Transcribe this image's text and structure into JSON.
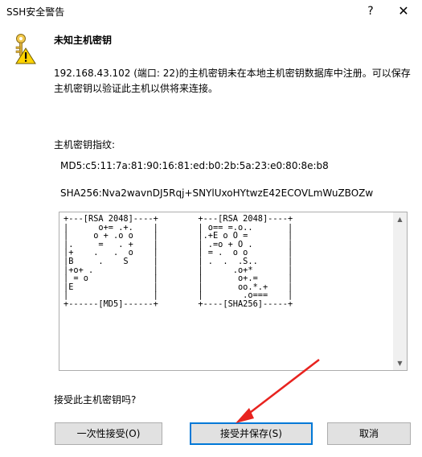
{
  "window": {
    "title": "SSH安全警告",
    "help_label": "?",
    "close_label": "✕"
  },
  "dialog": {
    "icon": "warning-key-icon",
    "heading": "未知主机密钥",
    "message": "192.168.43.102 (端口: 22)的主机密钥未在本地主机密钥数据库中注册。可以保存主机密钥以验证此主机以供将来连接。",
    "fingerprint_label": "主机密钥指纹:",
    "md5": "MD5:c5:11:7a:81:90:16:81:ed:b0:2b:5a:23:e0:80:8e:b8",
    "sha256": "SHA256:Nva2wavnDJ5Rqj+SNYlUxoHYtwzE42ECOVLmWuZBOZw",
    "randomart": "+---[RSA 2048]----+        +---[RSA 2048]----+\n|      o+= .+.    |        | o== =.o..       |\n|     o + .o o    |        |.+E o O =        |\n|.     =   . +    |        | .=o + O .       |\n|+    .   .  o    |        | = .  o o        |\n|B     .    S     |        | .  .  .S..      |\n|+o+ .            |        |      .o+*       |\n| = o             |        |       o+.=      |\n|E                |        |       oo.*.+    |\n|                 |        |        .o===    |\n+------[MD5]------+        +----[SHA256]-----+",
    "question": "接受此主机密钥吗?"
  },
  "buttons": {
    "accept_once": "一次性接受(O)",
    "accept_save": "接受并保存(S)",
    "cancel": "取消"
  },
  "colors": {
    "primary_border": "#0078d7",
    "button_bg": "#e1e1e1",
    "annotation_arrow": "#e8231f"
  }
}
